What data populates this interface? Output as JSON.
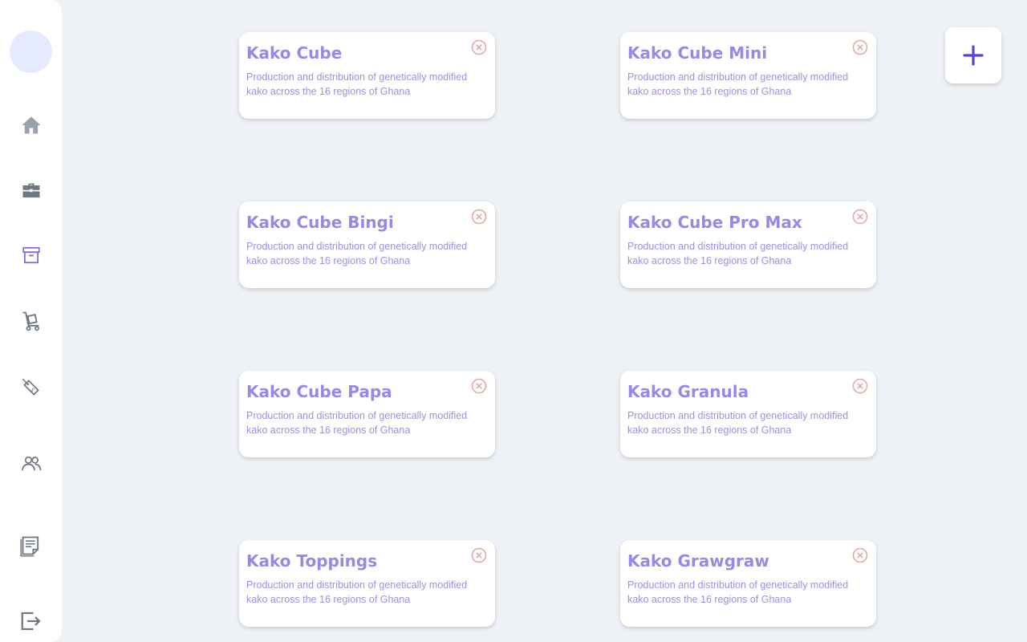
{
  "sidebar": {
    "avatar_color": "#e6eafd",
    "items": [
      {
        "icon": "home-icon"
      },
      {
        "icon": "briefcase-icon"
      },
      {
        "icon": "archive-icon"
      },
      {
        "icon": "hand-truck-icon"
      },
      {
        "icon": "price-tag-icon"
      },
      {
        "icon": "users-icon"
      },
      {
        "icon": "notes-icon"
      },
      {
        "icon": "logout-icon"
      }
    ]
  },
  "products": [
    {
      "title": "Kako Cube",
      "description": "Production and distribution of genetically modified kako across the 16 regions of Ghana"
    },
    {
      "title": "Kako Cube Mini",
      "description": "Production and distribution of genetically modified kako across the 16 regions of Ghana"
    },
    {
      "title": "Kako Cube Bingi",
      "description": "Production and distribution of genetically modified kako across the 16 regions of Ghana"
    },
    {
      "title": "Kako Cube Pro Max",
      "description": "Production and distribution of genetically modified kako across the 16 regions of Ghana"
    },
    {
      "title": "Kako Cube Papa",
      "description": "Production and distribution of genetically modified kako across the 16 regions of Ghana"
    },
    {
      "title": "Kako Granula",
      "description": "Production and distribution of genetically modified kako across the 16 regions of Ghana"
    },
    {
      "title": "Kako Toppings",
      "description": "Production and distribution of genetically modified kako across the 16 regions of Ghana"
    },
    {
      "title": "Kako Grawgraw",
      "description": "Production and distribution of genetically modified kako across the 16 regions of Ghana"
    }
  ],
  "add_button": {
    "icon": "plus-icon",
    "color": "#5a3fe0"
  },
  "colors": {
    "title": "#9a87e6",
    "description": "#9d8fe3",
    "close": "#e7a6a6",
    "icons": "#6f7780"
  }
}
